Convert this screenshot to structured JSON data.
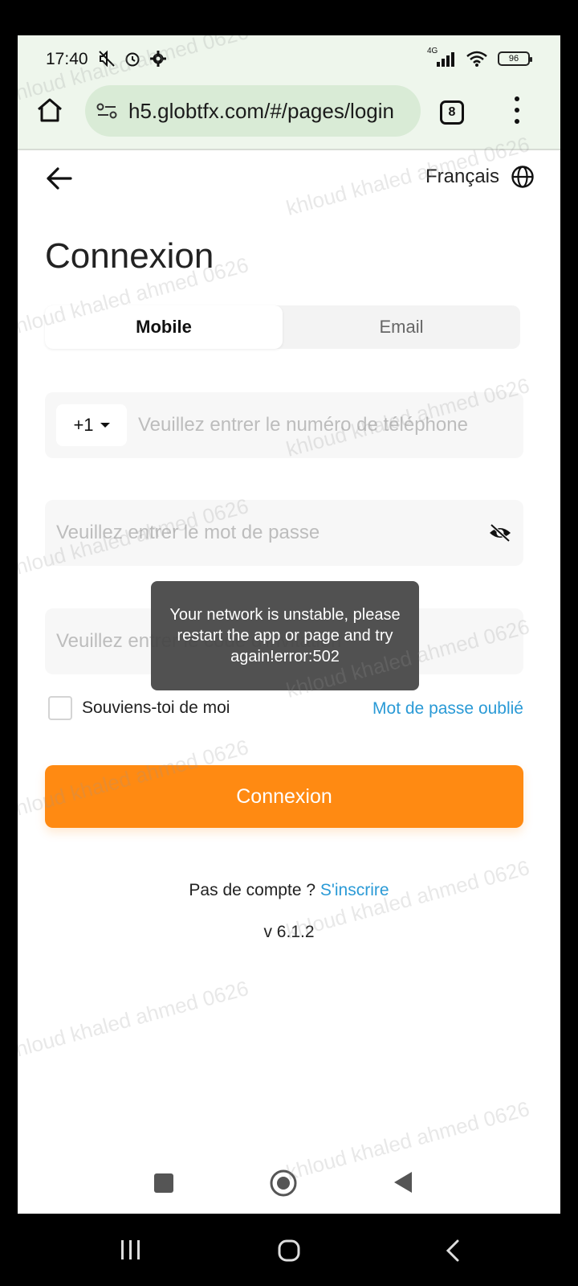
{
  "status_bar": {
    "time": "17:40",
    "network": "4G",
    "battery": "96"
  },
  "browser": {
    "url": "h5.globtfx.com/#/pages/login",
    "tab_count": "8"
  },
  "header": {
    "language": "Français"
  },
  "page": {
    "title": "Connexion",
    "tabs": [
      {
        "label": "Mobile",
        "active": true
      },
      {
        "label": "Email",
        "active": false
      }
    ],
    "phone": {
      "country_code": "+1",
      "placeholder": "Veuillez entrer le numéro de téléphone"
    },
    "password": {
      "placeholder": "Veuillez entrer le mot de passe"
    },
    "code": {
      "placeholder": "Veuillez entrer le code d'invitation"
    },
    "remember_label": "Souviens-toi de moi",
    "forgot_label": "Mot de passe oublié",
    "login_button": "Connexion",
    "signup_prompt": "Pas de compte ?",
    "signup_link": "S'inscrire",
    "version": "v 6.1.2"
  },
  "toast": {
    "message": "Your network is unstable, please restart the app or page and try again!error:502"
  },
  "watermark": "khloud khaled ahmed 0626",
  "colors": {
    "accent": "#ff8a12",
    "link": "#2a9ad6",
    "browser_bar": "#eef6ec"
  }
}
